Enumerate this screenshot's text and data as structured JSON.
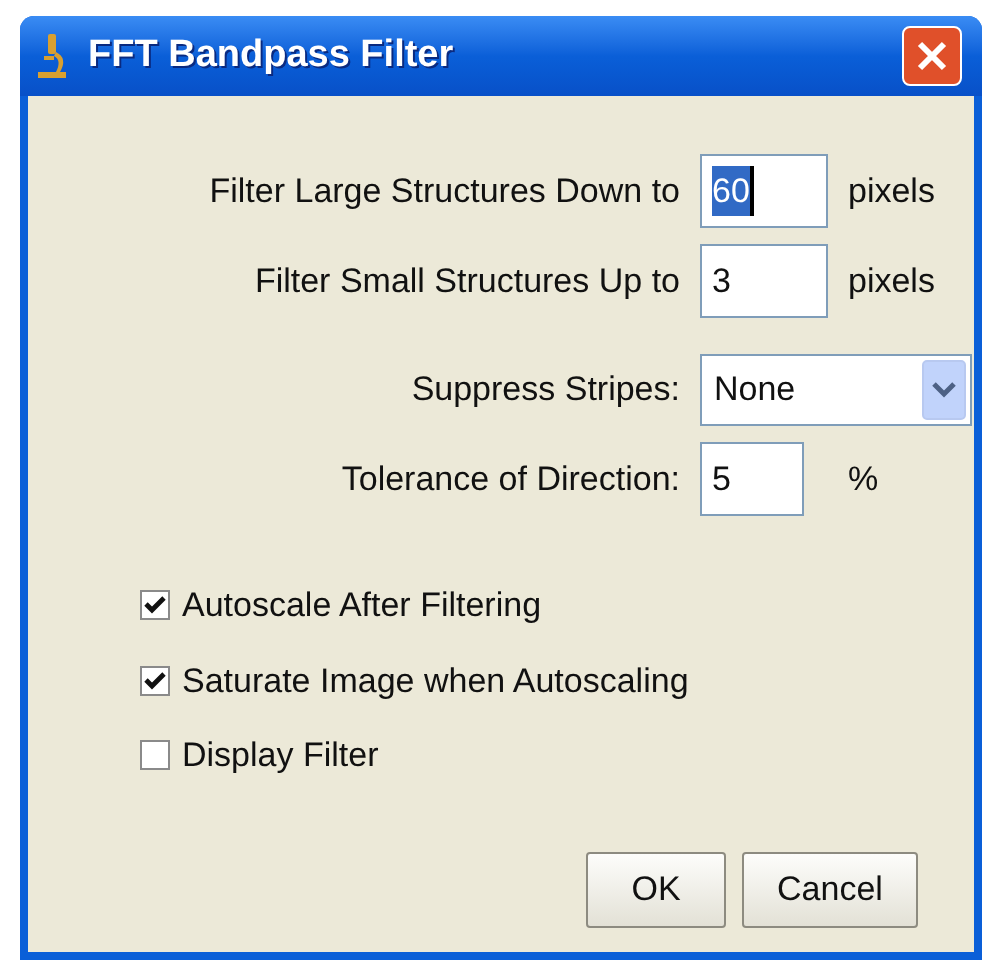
{
  "window": {
    "title": "FFT Bandpass Filter"
  },
  "fields": [
    {
      "kind": "number",
      "label": "Filter Large Structures Down to",
      "value": "60",
      "unit": "pixels",
      "text_selected": true
    },
    {
      "kind": "number",
      "label": "Filter Small Structures Up to",
      "value": "3",
      "unit": "pixels",
      "text_selected": false
    },
    {
      "kind": "dropdown",
      "label": "Suppress Stripes:",
      "value": "None"
    },
    {
      "kind": "short",
      "label": "Tolerance of Direction:",
      "value": "5",
      "unit": "%",
      "text_selected": false
    }
  ],
  "checkboxes": [
    {
      "label": "Autoscale After Filtering",
      "checked": true
    },
    {
      "label": "Saturate Image when Autoscaling",
      "checked": true
    },
    {
      "label": "Display Filter",
      "checked": false
    }
  ],
  "buttons": [
    "OK",
    "Cancel"
  ]
}
